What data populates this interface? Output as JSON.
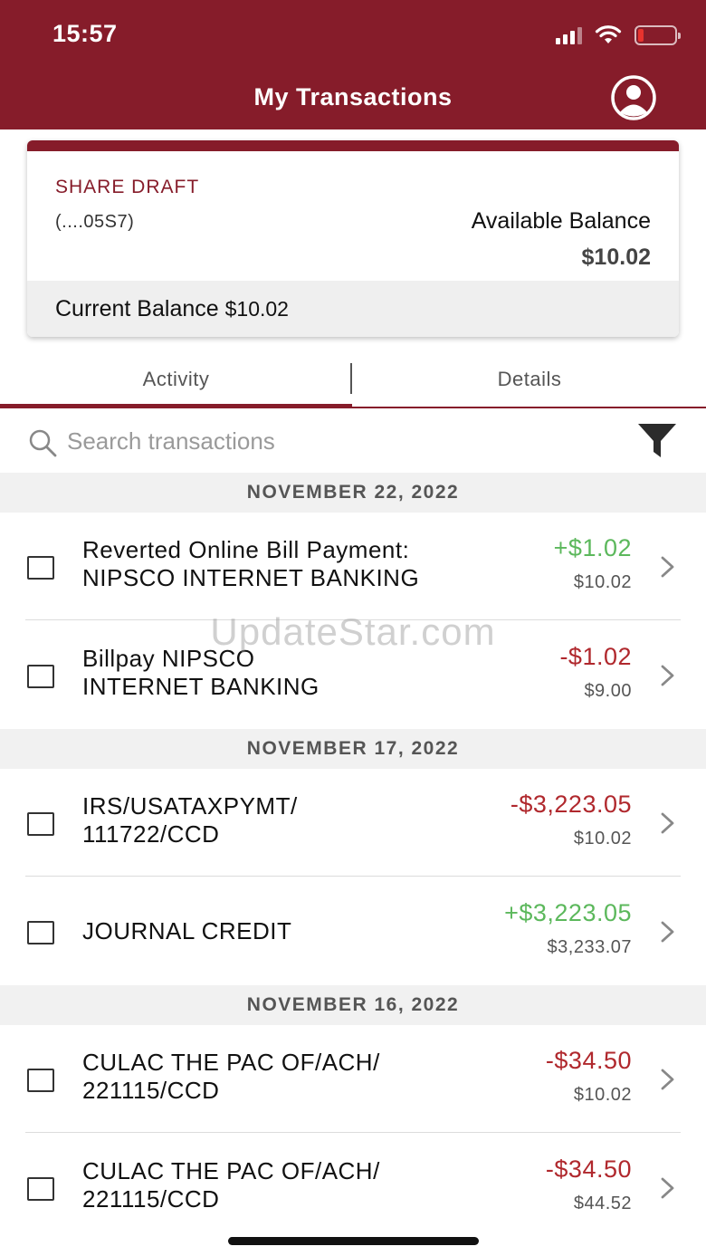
{
  "status_bar": {
    "time": "15:57"
  },
  "header": {
    "title": "My Transactions"
  },
  "account": {
    "name": "SHARE DRAFT",
    "number": "(....05S7)",
    "available_label": "Available Balance",
    "available_value": "$10.02",
    "current_label": "Current Balance",
    "current_value": "$10.02"
  },
  "tabs": [
    {
      "label": "Activity",
      "active": true
    },
    {
      "label": "Details",
      "active": false
    }
  ],
  "search": {
    "placeholder": "Search transactions"
  },
  "groups": [
    {
      "date": "NOVEMBER 22, 2022",
      "transactions": [
        {
          "line1": "Reverted Online Bill Payment:",
          "line2": "NIPSCO INTERNET BANKING",
          "amount": "+$1.02",
          "type": "credit",
          "balance": "$10.02"
        },
        {
          "line1": "Billpay NIPSCO",
          "line2": "INTERNET BANKING",
          "amount": "-$1.02",
          "type": "debit",
          "balance": "$9.00"
        }
      ]
    },
    {
      "date": "NOVEMBER 17, 2022",
      "transactions": [
        {
          "line1": "IRS/USATAXPYMT/",
          "line2": "111722/CCD",
          "amount": "-$3,223.05",
          "type": "debit",
          "balance": "$10.02"
        },
        {
          "line1": "JOURNAL CREDIT",
          "line2": "",
          "amount": "+$3,223.05",
          "type": "credit",
          "balance": "$3,233.07"
        }
      ]
    },
    {
      "date": "NOVEMBER 16, 2022",
      "transactions": [
        {
          "line1": "CULAC THE PAC OF/ACH/",
          "line2": "221115/CCD",
          "amount": "-$34.50",
          "type": "debit",
          "balance": "$10.02"
        },
        {
          "line1": "CULAC THE PAC OF/ACH/",
          "line2": "221115/CCD",
          "amount": "-$34.50",
          "type": "debit",
          "balance": "$44.52"
        }
      ]
    }
  ],
  "watermark": "UpdateStar.com",
  "colors": {
    "brand": "#861c2a",
    "credit": "#5cb85c",
    "debit": "#b0282d"
  }
}
